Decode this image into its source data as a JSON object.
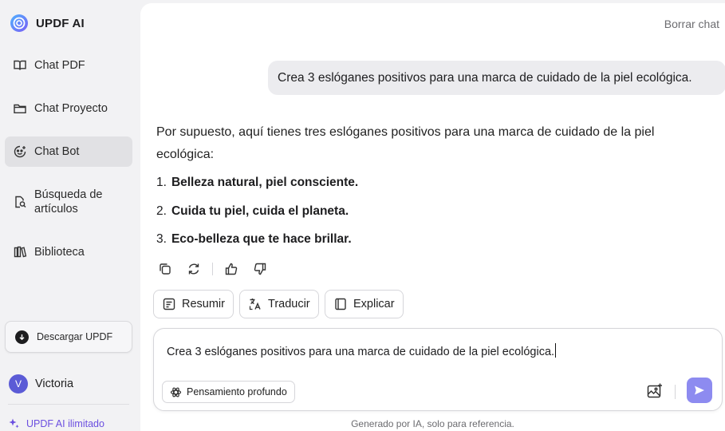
{
  "app": {
    "name": "UPDF AI"
  },
  "sidebar": {
    "items": [
      {
        "label": "Chat PDF",
        "icon": "book-open-icon"
      },
      {
        "label": "Chat Proyecto",
        "icon": "folder-icon"
      },
      {
        "label": "Chat Bot",
        "icon": "bot-face-icon",
        "active": true
      },
      {
        "label": "Búsqueda de artículos",
        "icon": "article-search-icon"
      },
      {
        "label": "Biblioteca",
        "icon": "library-icon"
      }
    ],
    "download_label": "Descargar UPDF",
    "user": {
      "initial": "V",
      "name": "Victoria"
    },
    "unlimited_label": "UPDF AI ilimitado"
  },
  "header": {
    "clear_chat": "Borrar chat"
  },
  "chat": {
    "user_message": "Crea 3 eslóganes positivos para una marca de cuidado de la piel ecológica.",
    "reply_intro": "Por supuesto, aquí tienes tres eslóganes positivos para una marca de cuidado de la piel ecológica:",
    "reply_items": [
      {
        "num": "1.",
        "text": "Belleza natural, piel consciente."
      },
      {
        "num": "2.",
        "text": "Cuida tu piel, cuida el planeta."
      },
      {
        "num": "3.",
        "text": "Eco-belleza que te hace brillar."
      }
    ]
  },
  "quick_actions": {
    "summarize": "Resumir",
    "translate": "Traducir",
    "explain": "Explicar"
  },
  "input": {
    "value": "Crea 3 eslóganes positivos para una marca de cuidado de la piel ecológica.",
    "deep_think": "Pensamiento profundo"
  },
  "footer": {
    "note": "Generado por IA, solo para referencia."
  },
  "colors": {
    "accent": "#8d8bf0",
    "avatar": "#5b5bd6",
    "unlimited": "#6b4fe0"
  }
}
